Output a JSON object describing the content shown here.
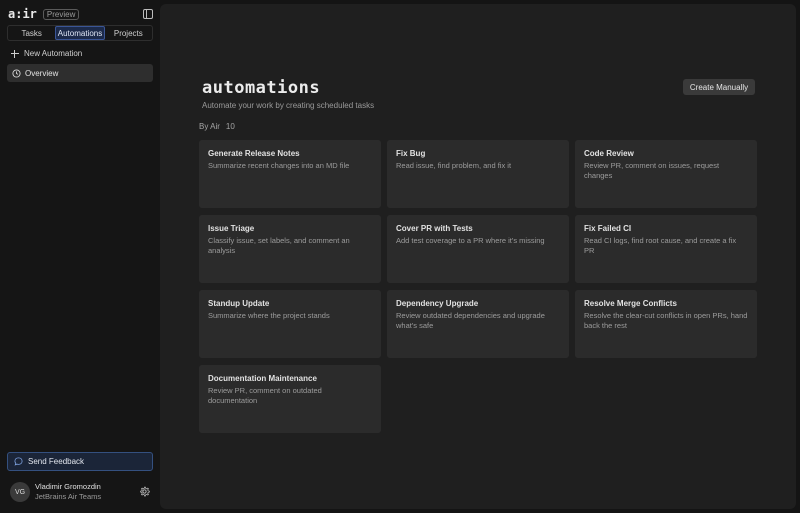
{
  "app": {
    "logo": "a:ir",
    "badge": "Preview"
  },
  "tabs": [
    {
      "label": "Tasks",
      "active": false
    },
    {
      "label": "Automations",
      "active": true
    },
    {
      "label": "Projects",
      "active": false
    }
  ],
  "sidebar": {
    "new_automation": "New Automation",
    "nav": [
      {
        "label": "Overview",
        "icon": "clock-icon",
        "selected": true
      }
    ],
    "feedback": "Send Feedback",
    "user": {
      "initials": "VG",
      "name": "Vladimir Gromozdin",
      "org": "JetBrains Air Teams"
    }
  },
  "main": {
    "title": "automations",
    "subtitle": "Automate your work by creating scheduled tasks",
    "create_button": "Create Manually",
    "section": {
      "label": "By Air",
      "count": "10"
    },
    "cards": [
      {
        "title": "Generate Release Notes",
        "desc": "Summarize recent changes into an MD file"
      },
      {
        "title": "Fix Bug",
        "desc": "Read issue, find problem, and fix it"
      },
      {
        "title": "Code Review",
        "desc": "Review PR, comment on issues, request changes"
      },
      {
        "title": "Issue Triage",
        "desc": "Classify issue, set labels, and comment an analysis"
      },
      {
        "title": "Cover PR with Tests",
        "desc": "Add test coverage to a PR where it's missing"
      },
      {
        "title": "Fix Failed CI",
        "desc": "Read CI logs, find root cause, and create a fix PR"
      },
      {
        "title": "Standup Update",
        "desc": "Summarize where the project stands"
      },
      {
        "title": "Dependency Upgrade",
        "desc": "Review outdated dependencies and upgrade what's safe"
      },
      {
        "title": "Resolve Merge Conflicts",
        "desc": "Resolve the clear-cut conflicts in open PRs, hand back the rest"
      },
      {
        "title": "Documentation Maintenance",
        "desc": "Review PR, comment on outdated documentation"
      }
    ]
  },
  "colors": {
    "accent_blue": "#3a5596",
    "feedback_bg": "#1b2538",
    "card_bg": "#2b2b2b",
    "main_bg": "#1f1f1f",
    "sidebar_bg": "#151515"
  }
}
